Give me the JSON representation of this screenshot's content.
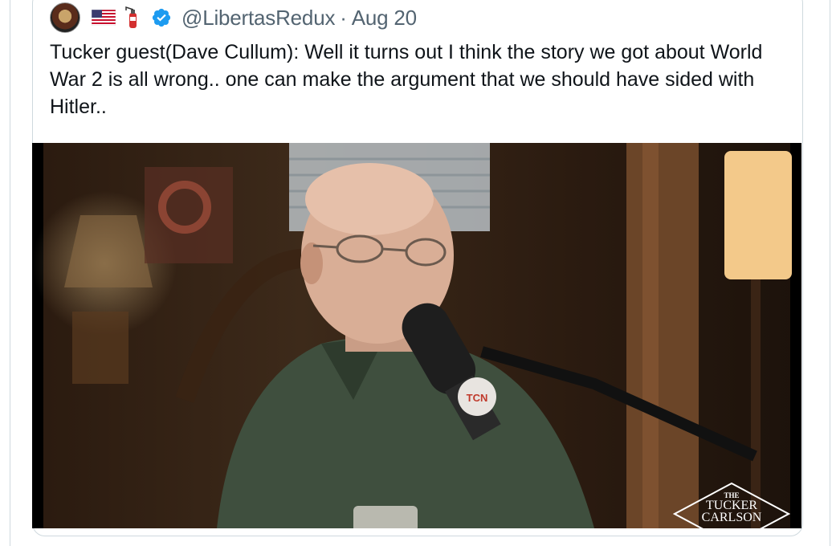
{
  "tweet": {
    "handle": "@LibertasRedux",
    "separator": "·",
    "date": "Aug 20",
    "text": "Tucker guest(Dave Cullum): Well it turns out I think the story we got about World War 2 is all wrong.. one can make the argument that we should have sided with Hitler..",
    "icons": [
      "avatar",
      "us-flag-icon",
      "fire-extinguisher-icon",
      "verified-badge-icon"
    ]
  },
  "media": {
    "mic_badge": "TCN",
    "watermark_the": "THE",
    "watermark_line1": "TUCKER",
    "watermark_line2": "CARLSON"
  },
  "colors": {
    "text": "#0f1419",
    "muted": "#536471",
    "verified": "#1d9bf0",
    "border": "#cfd9de"
  }
}
